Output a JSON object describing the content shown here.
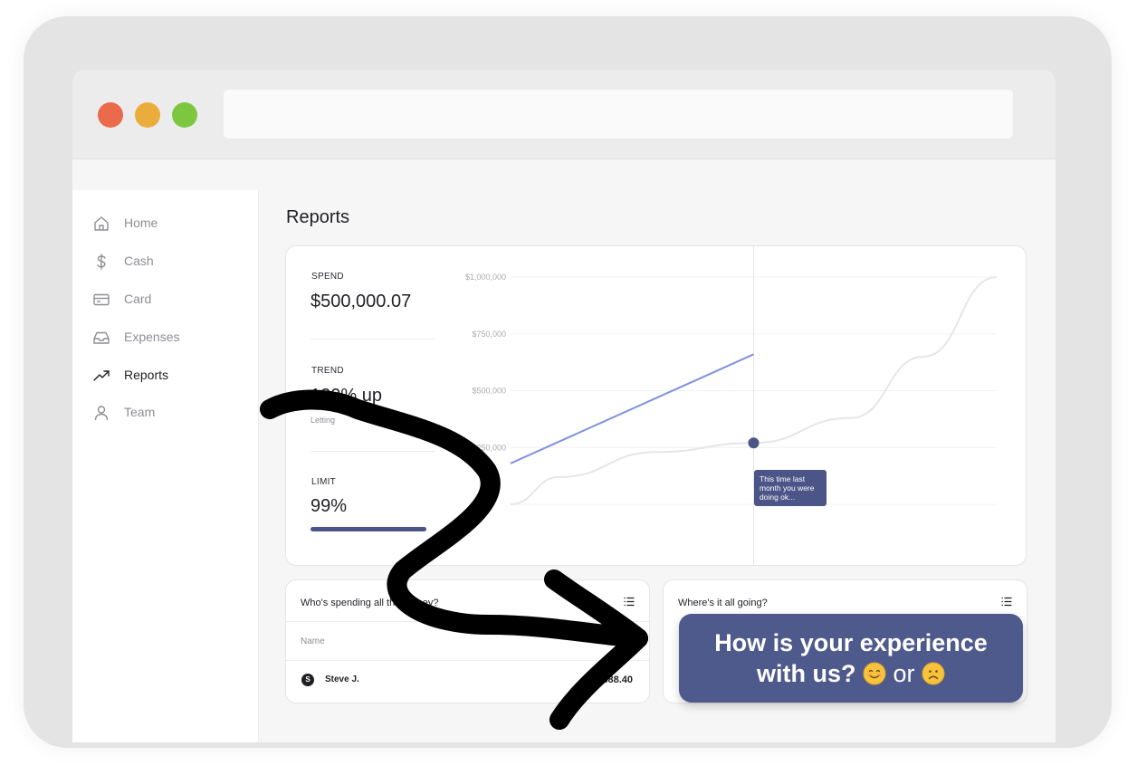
{
  "sidebar": {
    "items": [
      {
        "label": "Home",
        "icon": "home-icon"
      },
      {
        "label": "Cash",
        "icon": "dollar-icon"
      },
      {
        "label": "Card",
        "icon": "card-icon"
      },
      {
        "label": "Expenses",
        "icon": "inbox-icon"
      },
      {
        "label": "Reports",
        "icon": "trending-up-icon",
        "active": true
      },
      {
        "label": "Team",
        "icon": "user-icon"
      }
    ]
  },
  "main": {
    "title": "Reports",
    "stats": {
      "spend_label": "SPEND",
      "spend_value": "$500,000.07",
      "trend_label": "TREND",
      "trend_value": "120% up",
      "trend_sub": "Letting",
      "limit_label": "LIMIT",
      "limit_value": "99%",
      "limit_level": 0.99
    },
    "tooltip": "This time last month you were doing ok..."
  },
  "chart_data": {
    "type": "line",
    "y_ticks": [
      "$1,000,000",
      "$750,000",
      "$500,000",
      "$250,000"
    ],
    "ylim": [
      0,
      1000000
    ],
    "series": [
      {
        "values_note_color": "#7f92dc",
        "color": "#7f92dc",
        "points": [
          [
            0,
            180000
          ],
          [
            0.5,
            660000
          ]
        ]
      },
      {
        "color": "#e6e6e6",
        "points": [
          [
            0,
            0
          ],
          [
            0.1,
            120000
          ],
          [
            0.3,
            230000
          ],
          [
            0.5,
            270000
          ],
          [
            0.7,
            380000
          ],
          [
            0.85,
            650000
          ],
          [
            1,
            1000000
          ]
        ]
      }
    ],
    "highlight": {
      "x": 0.5,
      "y": 270000,
      "color": "#4b5587"
    }
  },
  "panels": {
    "left": {
      "title": "Who's spending all the money?",
      "column": "Name",
      "rows": [
        {
          "initial": "S",
          "name": "Steve J.",
          "amount": "$388.40"
        }
      ]
    },
    "right": {
      "title": "Where's it all going?"
    }
  },
  "feedback": {
    "line1": "How is your experience",
    "line2": "with us?",
    "or": "or",
    "happy_icon": "smiling-face-icon",
    "sad_icon": "frowning-face-icon"
  },
  "colors": {
    "accent": "#4b5587",
    "feedback_bg": "#4f5a8c",
    "traffic_red": "#eb6a4c",
    "traffic_yellow": "#eaad3b",
    "traffic_green": "#7dc740"
  }
}
